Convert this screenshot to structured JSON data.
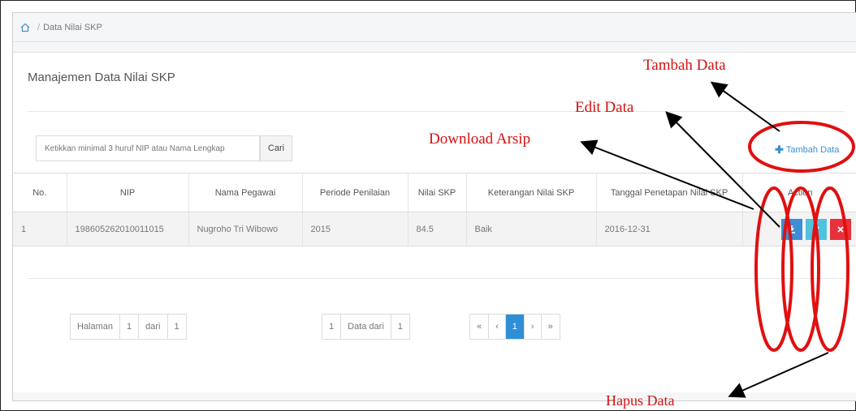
{
  "breadcrumb": {
    "current": "Data Nilai SKP"
  },
  "page": {
    "title": "Manajemen Data Nilai SKP"
  },
  "search": {
    "placeholder": "Ketikkan minimal 3 huruf NIP atau Nama Lengkap",
    "button": "Cari"
  },
  "actions": {
    "add_label": "Tambah Data"
  },
  "table": {
    "headers": [
      "No.",
      "NIP",
      "Nama Pegawai",
      "Periode Penilaian",
      "Nilai SKP",
      "Keterangan Nilai SKP",
      "Tanggal Penetapan Nilai SKP",
      "Action"
    ],
    "rows": [
      {
        "no": "1",
        "nip": "198605262010011015",
        "nama": "Nugroho Tri Wibowo",
        "periode": "2015",
        "nilai": "84.5",
        "keterangan": "Baik",
        "tanggal": "2016-12-31"
      }
    ]
  },
  "pagination": {
    "halaman_label": "Halaman",
    "page": "1",
    "dari_label": "dari",
    "total_pages": "1",
    "count": "1",
    "data_dari_label": "Data dari",
    "total": "1",
    "first": "«",
    "prev": "‹",
    "current": "1",
    "next": "›",
    "last": "»"
  },
  "annotations": {
    "tambah": "Tambah Data",
    "edit": "Edit Data",
    "download": "Download Arsip",
    "hapus": "Hapus Data"
  },
  "colors": {
    "accent": "#3d8ed6",
    "edit": "#4fc2de",
    "delete": "#e7323b",
    "annotation": "#d41111"
  },
  "icons": {
    "home": "home-icon",
    "plus": "plus-icon",
    "download": "download-icon",
    "edit": "pencil-icon",
    "delete": "close-icon"
  }
}
